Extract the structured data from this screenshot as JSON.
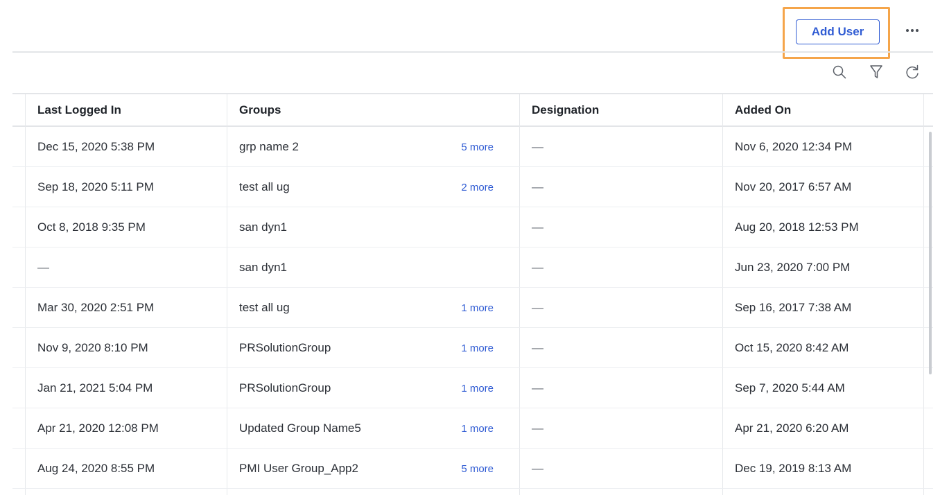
{
  "header": {
    "add_user_label": "Add User"
  },
  "toolbar": {
    "icons": [
      "search-icon",
      "filter-icon",
      "refresh-icon"
    ]
  },
  "colors": {
    "accent": "#2f5bd3",
    "highlight": "#f5a54a",
    "border": "#e3e5e8"
  },
  "table": {
    "columns": [
      "Last Logged In",
      "Groups",
      "Designation",
      "Added On"
    ],
    "rows": [
      {
        "last_logged_in": "Dec 15, 2020 5:38 PM",
        "group": "grp name 2",
        "more": "5 more",
        "designation": "—",
        "added_on": "Nov 6, 2020 12:34 PM"
      },
      {
        "last_logged_in": "Sep 18, 2020 5:11 PM",
        "group": "test all ug",
        "more": "2 more",
        "designation": "—",
        "added_on": "Nov 20, 2017 6:57 AM"
      },
      {
        "last_logged_in": "Oct 8, 2018 9:35 PM",
        "group": "san dyn1",
        "more": "",
        "designation": "—",
        "added_on": "Aug 20, 2018 12:53 PM"
      },
      {
        "last_logged_in": "—",
        "group": "san dyn1",
        "more": "",
        "designation": "—",
        "added_on": "Jun 23, 2020 7:00 PM"
      },
      {
        "last_logged_in": "Mar 30, 2020 2:51 PM",
        "group": "test all ug",
        "more": "1 more",
        "designation": "—",
        "added_on": "Sep 16, 2017 7:38 AM"
      },
      {
        "last_logged_in": "Nov 9, 2020 8:10 PM",
        "group": "PRSolutionGroup",
        "more": "1 more",
        "designation": "—",
        "added_on": "Oct 15, 2020 8:42 AM"
      },
      {
        "last_logged_in": "Jan 21, 2021 5:04 PM",
        "group": "PRSolutionGroup",
        "more": "1 more",
        "designation": "—",
        "added_on": "Sep 7, 2020 5:44 AM"
      },
      {
        "last_logged_in": "Apr 21, 2020 12:08 PM",
        "group": "Updated Group Name5",
        "more": "1 more",
        "designation": "—",
        "added_on": "Apr 21, 2020 6:20 AM"
      },
      {
        "last_logged_in": "Aug 24, 2020 8:55 PM",
        "group": "PMI User Group_App2",
        "more": "5 more",
        "designation": "—",
        "added_on": "Dec 19, 2019 8:13 AM"
      }
    ]
  }
}
